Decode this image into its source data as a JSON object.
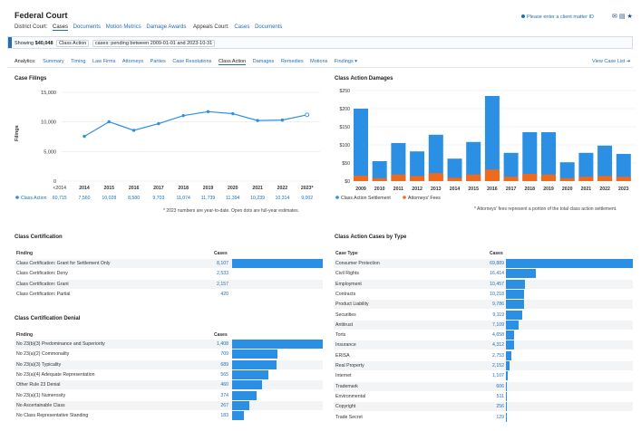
{
  "header": {
    "title": "Federal Court",
    "district_label": "District Court:",
    "district_links": [
      "Cases",
      "Documents",
      "Motion Metrics",
      "Damage Awards"
    ],
    "appeals_label": "Appeals Court:",
    "appeals_links": [
      "Cases",
      "Documents"
    ],
    "client_matter": "Please enter a client matter ID"
  },
  "filter": {
    "showing": "Showing",
    "count": "$40,048",
    "filter1": "Class Action",
    "filter2_label": "cases",
    "filter2": "pending between 2009-01-01 and 2023-10-31"
  },
  "analytics": {
    "label": "Analytics:",
    "tabs": [
      "Summary",
      "Timing",
      "Law Firms",
      "Attorneys",
      "Parties",
      "Case Resolutions",
      "Class Action",
      "Damages",
      "Remedies",
      "Motions",
      "Findings ▾"
    ],
    "active": "Class Action",
    "view_case_list": "View Case List"
  },
  "case_filings": {
    "title": "Case Filings",
    "ylabel": "Filings",
    "note": "* 2023 numbers are year-to-date. Open dots are full-year estimates.",
    "row_label": "Class Action",
    "years": [
      "<2014",
      "2014",
      "2015",
      "2016",
      "2017",
      "2018",
      "2019",
      "2020",
      "2021",
      "2022",
      "2023*"
    ],
    "values_text": [
      "60,715",
      "7,560",
      "10,028",
      "8,580",
      "9,703",
      "11,074",
      "11,739",
      "11,394",
      "10,239",
      "10,314",
      "9,002"
    ]
  },
  "damages": {
    "title": "Class Action Damages",
    "legend": [
      "Class Action Settlement",
      "Attorneys' Fees"
    ],
    "note": "* Attorneys' fees represent a portion of the total class action settlement."
  },
  "chart_data": [
    {
      "type": "line",
      "title": "Case Filings",
      "ylabel": "Filings",
      "x": [
        "2014",
        "2015",
        "2016",
        "2017",
        "2018",
        "2019",
        "2020",
        "2021",
        "2022",
        "2023"
      ],
      "series": [
        {
          "name": "Class Action",
          "values": [
            7560,
            10028,
            8580,
            9703,
            11074,
            11739,
            11394,
            10239,
            10314,
            11200
          ]
        }
      ],
      "yticks": [
        "0",
        "5,000",
        "10,000",
        "15,000"
      ],
      "ylim": [
        0,
        15000
      ],
      "grid": true
    },
    {
      "type": "bar",
      "title": "Class Action Damages",
      "categories": [
        "2009",
        "2010",
        "2011",
        "2012",
        "2013",
        "2014",
        "2015",
        "2016",
        "2017",
        "2018",
        "2019",
        "2020",
        "2021",
        "2022",
        "2023"
      ],
      "series": [
        {
          "name": "Class Action Settlement",
          "values": [
            200,
            55,
            105,
            82,
            128,
            62,
            108,
            235,
            78,
            135,
            135,
            52,
            78,
            98,
            75
          ]
        },
        {
          "name": "Attorneys' Fees",
          "values": [
            15,
            8,
            18,
            14,
            22,
            9,
            18,
            32,
            12,
            20,
            18,
            8,
            12,
            14,
            12
          ]
        }
      ],
      "yticks": [
        "$0",
        "$50",
        "$100",
        "$150",
        "$200",
        "$250"
      ],
      "ylim": [
        0,
        250
      ],
      "legend": "bottom-left",
      "grid": true
    }
  ],
  "class_cert": {
    "title": "Class Certification",
    "col1": "Finding",
    "col2": "Cases",
    "rows": [
      {
        "label": "Class Certification: Grant for Settlement Only",
        "value": "8,107",
        "frac": 1.0
      },
      {
        "label": "Class Certification: Deny",
        "value": "2,533",
        "frac": 0.0
      },
      {
        "label": "Class Certification: Grant",
        "value": "2,157",
        "frac": 0.0
      },
      {
        "label": "Class Certification: Partial",
        "value": "420",
        "frac": 0.0
      }
    ]
  },
  "cert_denial": {
    "title": "Class Certification Denial",
    "col1": "Finding",
    "col2": "Cases",
    "rows": [
      {
        "label": "No 23(b)(3) Predominance and Superiority",
        "value": "1,408",
        "frac": 1.0
      },
      {
        "label": "No 23(a)(2) Commonality",
        "value": "709",
        "frac": 0.5
      },
      {
        "label": "No 23(a)(3) Typicality",
        "value": "689",
        "frac": 0.49
      },
      {
        "label": "No 23(a)(4) Adequate Representation",
        "value": "565",
        "frac": 0.4
      },
      {
        "label": "Other Rule 23 Denial",
        "value": "460",
        "frac": 0.33
      },
      {
        "label": "No 23(a)(1) Numerosity",
        "value": "374",
        "frac": 0.27
      },
      {
        "label": "No Ascertainable Class",
        "value": "267",
        "frac": 0.19
      },
      {
        "label": "No Class Representative Standing",
        "value": "183",
        "frac": 0.13
      }
    ]
  },
  "by_type": {
    "title": "Class Action Cases by Type",
    "col1": "Case Type",
    "col2": "Cases",
    "rows": [
      {
        "label": "Consumer Protection",
        "value": "69,889",
        "frac": 1.0
      },
      {
        "label": "Civil Rights",
        "value": "16,414",
        "frac": 0.235
      },
      {
        "label": "Employment",
        "value": "10,457",
        "frac": 0.15
      },
      {
        "label": "Contracts",
        "value": "10,218",
        "frac": 0.146
      },
      {
        "label": "Product Liability",
        "value": "9,786",
        "frac": 0.14
      },
      {
        "label": "Securities",
        "value": "9,119",
        "frac": 0.13
      },
      {
        "label": "Antitrust",
        "value": "7,109",
        "frac": 0.102
      },
      {
        "label": "Torts",
        "value": "4,658",
        "frac": 0.067
      },
      {
        "label": "Insurance",
        "value": "4,312",
        "frac": 0.062
      },
      {
        "label": "ERISA",
        "value": "2,753",
        "frac": 0.04
      },
      {
        "label": "Real Property",
        "value": "2,152",
        "frac": 0.031
      },
      {
        "label": "Internet",
        "value": "1,107",
        "frac": 0.016
      },
      {
        "label": "Trademark",
        "value": "606",
        "frac": 0.009
      },
      {
        "label": "Environmental",
        "value": "511",
        "frac": 0.007
      },
      {
        "label": "Copyright",
        "value": "256",
        "frac": 0.004
      },
      {
        "label": "Trade Secret",
        "value": "129",
        "frac": 0.002
      }
    ]
  },
  "colors": {
    "accent": "#1f6fb5",
    "bar": "#2b8fe3",
    "fees": "#f06a1d"
  }
}
